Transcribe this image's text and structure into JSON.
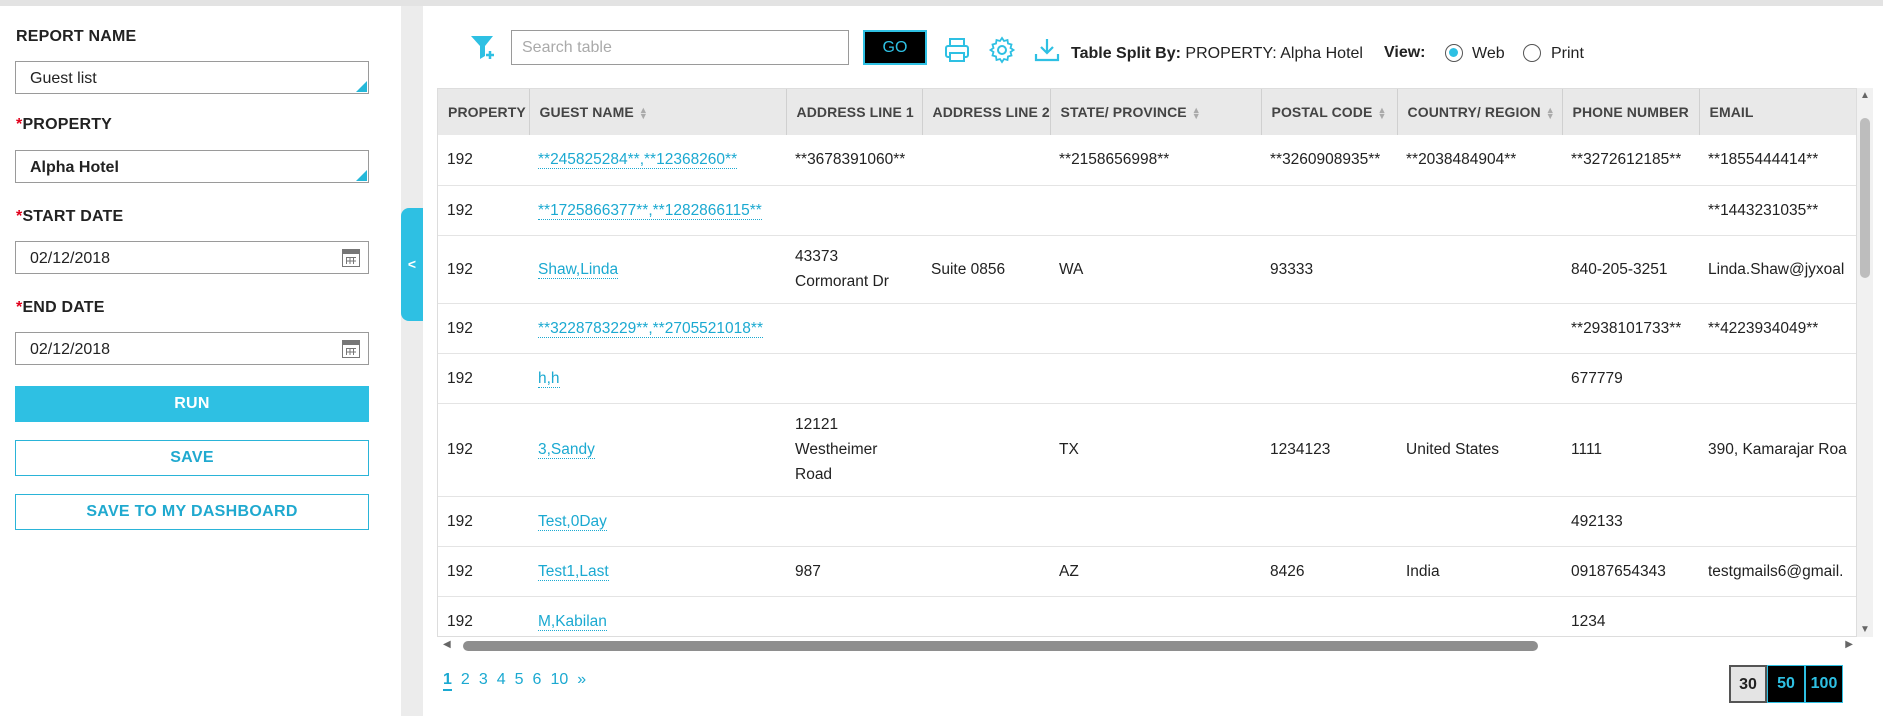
{
  "left_panel": {
    "report_name_label": "REPORT NAME",
    "report_name_value": "Guest list",
    "property_label": "PROPERTY",
    "property_value": "Alpha Hotel",
    "start_date_label": "START DATE",
    "start_date_value": "02/12/2018",
    "end_date_label": "END DATE",
    "end_date_value": "02/12/2018",
    "required_mark": "*",
    "run_label": "RUN",
    "save_label": "SAVE",
    "save_dashboard_label": "SAVE TO MY DASHBOARD",
    "collapse_glyph": "<"
  },
  "toolbar": {
    "search_placeholder": "Search table",
    "go_label": "GO",
    "split_label": "Table Split By:",
    "split_value": "PROPERTY: Alpha Hotel",
    "view_label": "View:",
    "view_options": [
      "Web",
      "Print"
    ],
    "view_selected": "Web",
    "icons": [
      "filter-add-icon",
      "print-icon",
      "settings-gear-icon",
      "download-icon"
    ],
    "accent_color": "#2ec0e3"
  },
  "table": {
    "columns": [
      "PROPERTY",
      "GUEST NAME",
      "ADDRESS LINE 1",
      "ADDRESS LINE 2",
      "STATE/ PROVINCE",
      "POSTAL CODE",
      "COUNTRY/ REGION",
      "PHONE NUMBER",
      "EMAIL"
    ],
    "rows": [
      [
        "192",
        "**245825284**,**12368260**",
        "**3678391060**",
        "",
        "**2158656998**",
        "**3260908935**",
        "**2038484904**",
        "**3272612185**",
        "**1855444414**"
      ],
      [
        "192",
        "**1725866377**,**1282866115**",
        "",
        "",
        "",
        "",
        "",
        "",
        "**1443231035**"
      ],
      [
        "192",
        "Shaw,Linda",
        "43373 Cormorant Dr",
        "Suite 0856",
        "WA",
        "93333",
        "",
        "840-205-3251",
        "Linda.Shaw@jyxoal"
      ],
      [
        "192",
        "**3228783229**,**2705521018**",
        "",
        "",
        "",
        "",
        "",
        "**2938101733**",
        "**4223934049**"
      ],
      [
        "192",
        "h,h",
        "",
        "",
        "",
        "",
        "",
        "677779",
        ""
      ],
      [
        "192",
        "3,Sandy",
        "12121 Westheimer Road",
        "",
        "TX",
        "1234123",
        "United States",
        "1111",
        "390, Kamarajar Roa"
      ],
      [
        "192",
        "Test,0Day",
        "",
        "",
        "",
        "",
        "",
        "492133",
        ""
      ],
      [
        "192",
        "Test1,Last",
        "987",
        "",
        "AZ",
        "8426",
        "India",
        "09187654343",
        "testgmails6@gmail."
      ],
      [
        "192",
        "M,Kabilan",
        "",
        "",
        "",
        "",
        "",
        "1234",
        ""
      ]
    ]
  },
  "pagination": {
    "pages": [
      "1",
      "2",
      "3",
      "4",
      "5",
      "6",
      "10",
      "»"
    ],
    "current": "1",
    "page_sizes": [
      "30",
      "50",
      "100"
    ],
    "page_size_selected": "30"
  }
}
